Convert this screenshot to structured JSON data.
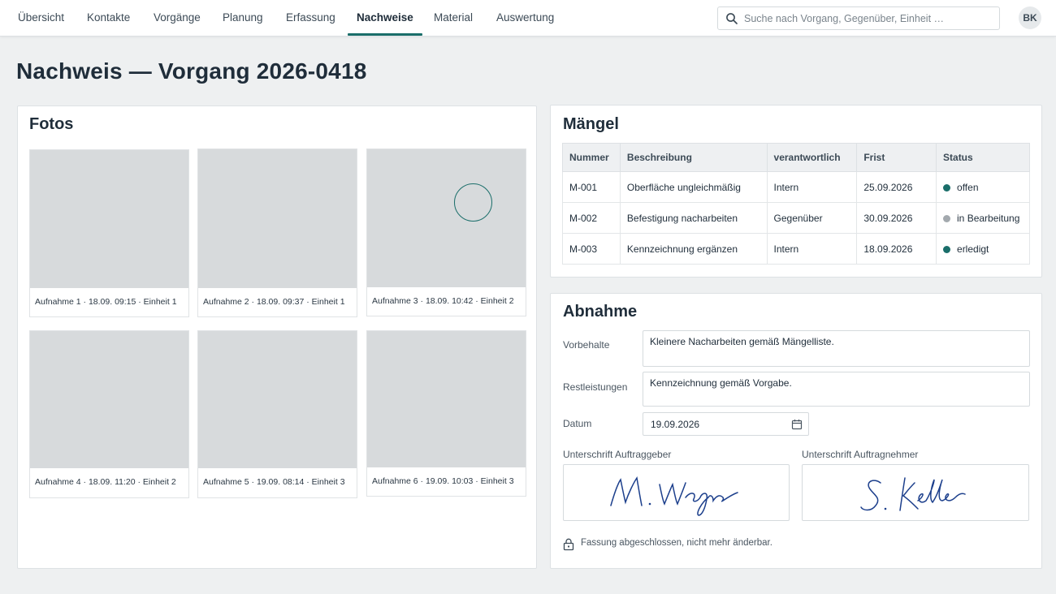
{
  "nav": {
    "items": [
      {
        "label": "Übersicht",
        "active": false
      },
      {
        "label": "Kontakte",
        "active": false
      },
      {
        "label": "Vorgänge",
        "active": false
      },
      {
        "label": "Planung",
        "active": false
      },
      {
        "label": "Erfassung",
        "active": false
      },
      {
        "label": "Nachweise",
        "active": true
      },
      {
        "label": "Material",
        "active": false
      },
      {
        "label": "Auswertung",
        "active": false
      }
    ],
    "search_placeholder": "Suche nach Vorgang, Gegenüber, Einheit …",
    "avatar": "BK"
  },
  "page": {
    "title": "Nachweis — Vorgang 2026-0418"
  },
  "photos": {
    "title": "Fotos",
    "items": [
      {
        "caption": "Aufnahme 1  ·  18.09. 09:15  ·  Einheit 1"
      },
      {
        "caption": "Aufnahme 2  ·  18.09. 09:37  ·  Einheit 1"
      },
      {
        "caption": "Aufnahme 3  ·  18.09. 10:42  ·  Einheit 2"
      },
      {
        "caption": "Aufnahme 4  ·  18.09. 11:20  ·  Einheit 2"
      },
      {
        "caption": "Aufnahme 5  ·  19.09. 08:14  ·  Einheit 3"
      },
      {
        "caption": "Aufnahme 6  ·  19.09. 10:03  ·  Einheit 3"
      }
    ]
  },
  "defects": {
    "title": "Mängel",
    "columns": [
      "Nummer",
      "Beschreibung",
      "verantwortlich",
      "Frist",
      "Status"
    ],
    "rows": [
      {
        "nummer": "M-001",
        "beschreibung": "Oberfläche ungleichmäßig",
        "verantwortlich": "Intern",
        "frist": "25.09.2026",
        "status": "offen",
        "status_color": "#1a6e6a"
      },
      {
        "nummer": "M-002",
        "beschreibung": "Befestigung nacharbeiten",
        "verantwortlich": "Gegenüber",
        "frist": "30.09.2026",
        "status": "in Bearbeitung",
        "status_color": "#a3a9ae"
      },
      {
        "nummer": "M-003",
        "beschreibung": "Kennzeichnung ergänzen",
        "verantwortlich": "Intern",
        "frist": "18.09.2026",
        "status": "erledigt",
        "status_color": "#1a6e6a"
      }
    ]
  },
  "acceptance": {
    "title": "Abnahme",
    "vorbehalte_label": "Vorbehalte",
    "vorbehalte_value": "Kleinere Nacharbeiten gemäß Mängelliste.",
    "restleistungen_label": "Restleistungen",
    "restleistungen_value": "Kennzeichnung gemäß Vorgabe.",
    "datum_label": "Datum",
    "datum_value": "19.09.2026",
    "sig_client_label": "Unterschrift Auftraggeber",
    "sig_contractor_label": "Unterschrift Auftragnehmer",
    "lock_note": "Fassung abgeschlossen, nicht mehr änderbar."
  },
  "colors": {
    "accent": "#1a6e6a",
    "photo_placeholder": "#d7dadc",
    "signature_ink": "#1c3f8c"
  }
}
